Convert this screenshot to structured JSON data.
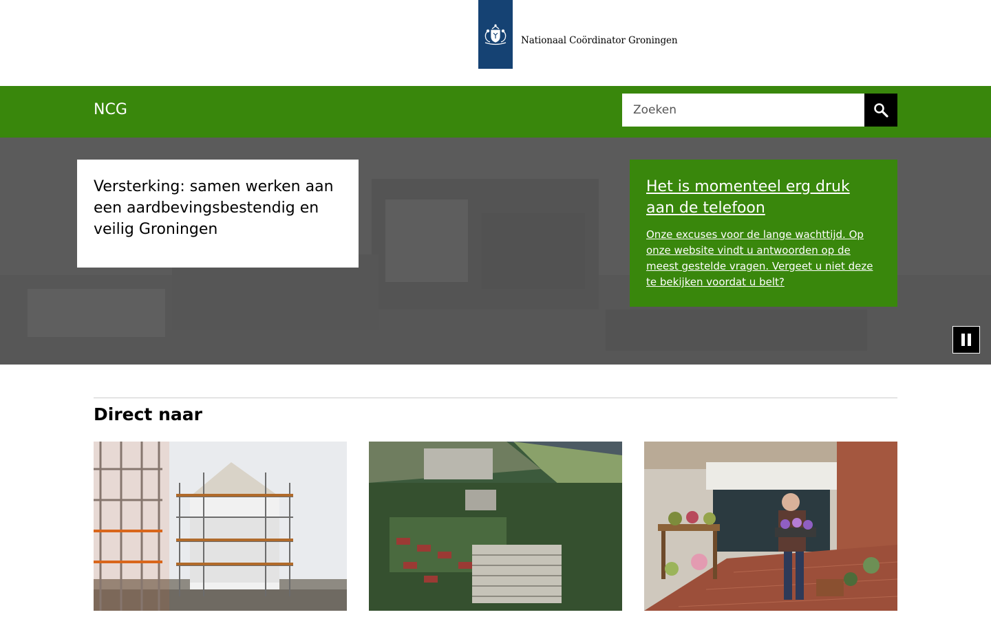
{
  "logo": {
    "org_name": "Nationaal Coördinator Groningen",
    "brand_color": "#154273"
  },
  "nav": {
    "site_name": "NCG",
    "bar_color": "#39870c",
    "search": {
      "placeholder": "Zoeken",
      "value": "",
      "button_icon": "search-icon"
    }
  },
  "hero": {
    "card_title": "Versterking: samen werken aan een aardbevingsbestendig en veilig Groningen",
    "notice": {
      "title": "Het is momenteel erg druk aan de telefoon",
      "body": "Onze excuses voor de lange wachttijd. Op onze website vindt u antwoorden op de meest gestelde vragen. Vergeet u niet deze te bekijken voordat u belt?"
    },
    "pause_icon": "pause-icon"
  },
  "direct_naar": {
    "title": "Direct naar",
    "tiles": [
      {
        "image": "house-with-scaffolding-photo"
      },
      {
        "image": "aerial-view-apartment-flats-photo"
      },
      {
        "image": "flower-shop-owner-photo"
      }
    ]
  }
}
